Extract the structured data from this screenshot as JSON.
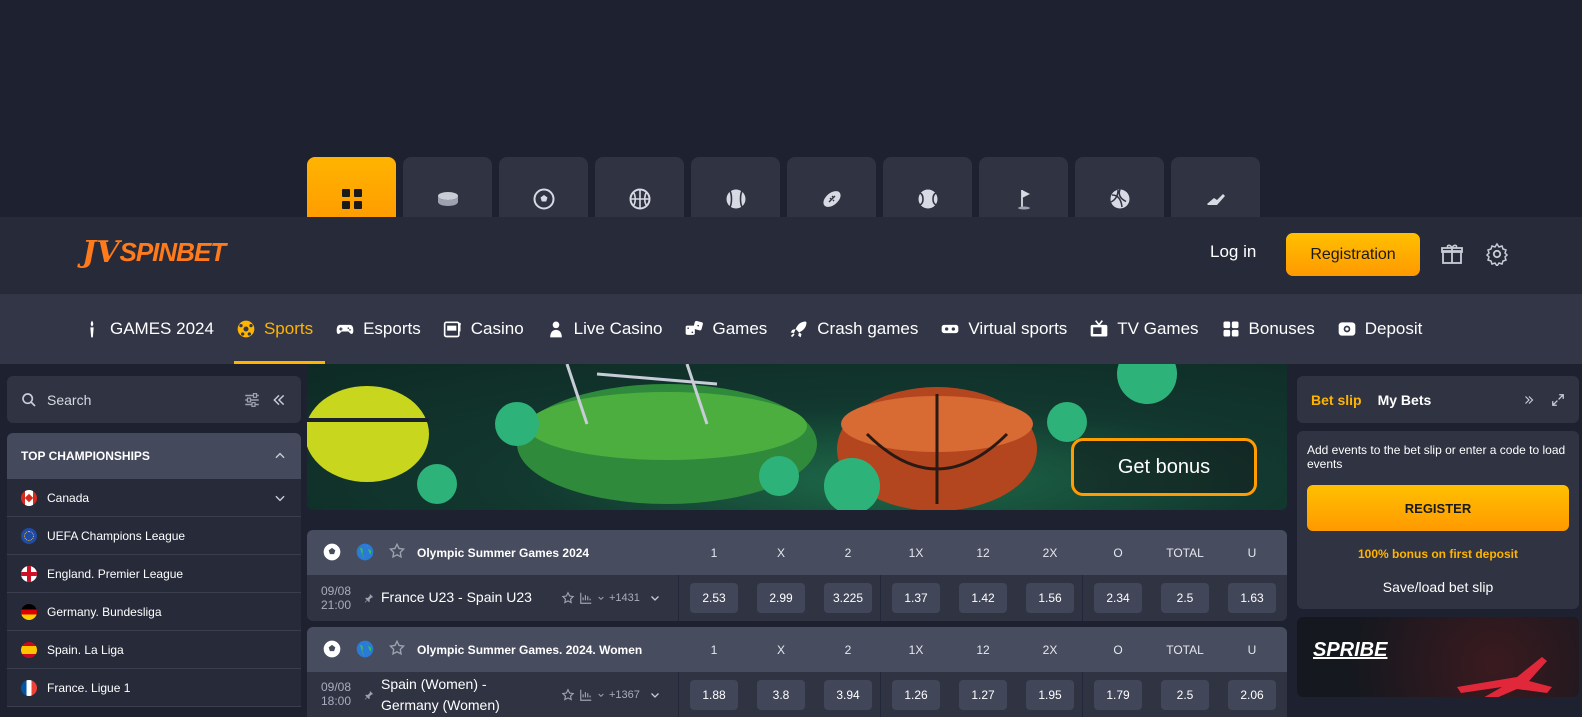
{
  "tiles": [
    {
      "icon": "grid-icon",
      "active": true
    },
    {
      "icon": "puck-icon"
    },
    {
      "icon": "soccer-ball-icon"
    },
    {
      "icon": "basketball-icon"
    },
    {
      "icon": "baseball-icon"
    },
    {
      "icon": "american-football-icon"
    },
    {
      "icon": "tennis-ball-icon"
    },
    {
      "icon": "golf-flag-icon"
    },
    {
      "icon": "volleyball-icon"
    },
    {
      "icon": "sneaker-icon"
    }
  ],
  "header": {
    "logo_mark": "JV",
    "logo_text": "SPINBET",
    "login_label": "Log in",
    "register_label": "Registration"
  },
  "nav": [
    {
      "label": "GAMES 2024",
      "icon": "torch-icon"
    },
    {
      "label": "Sports",
      "icon": "sports-icon",
      "active": true
    },
    {
      "label": "Esports",
      "icon": "gamepad-icon"
    },
    {
      "label": "Casino",
      "icon": "slot-icon"
    },
    {
      "label": "Live Casino",
      "icon": "dealer-icon"
    },
    {
      "label": "Games",
      "icon": "dice-icon"
    },
    {
      "label": "Crash games",
      "icon": "rocket-icon"
    },
    {
      "label": "Virtual sports",
      "icon": "vr-icon"
    },
    {
      "label": "TV Games",
      "icon": "tv-icon"
    },
    {
      "label": "Bonuses",
      "icon": "gift-box-icon"
    },
    {
      "label": "Deposit",
      "icon": "wallet-icon"
    }
  ],
  "sidebar": {
    "search_placeholder": "Search",
    "top_title": "TOP CHAMPIONSHIPS",
    "items": [
      {
        "label": "Canada",
        "flag": "ca"
      },
      {
        "label": "UEFA Champions League",
        "flag": "eu"
      },
      {
        "label": "England. Premier League",
        "flag": "en"
      },
      {
        "label": "Germany. Bundesliga",
        "flag": "de"
      },
      {
        "label": "Spain. La Liga",
        "flag": "es"
      },
      {
        "label": "France. Ligue 1",
        "flag": "fr"
      }
    ]
  },
  "banner": {
    "cta": "Get bonus"
  },
  "columns": [
    "1",
    "X",
    "2",
    "1X",
    "12",
    "2X",
    "O",
    "TOTAL",
    "U"
  ],
  "events": [
    {
      "title": "Olympic Summer Games 2024",
      "date": "09/08",
      "time": "21:00",
      "teams": "France U23 - Spain U23",
      "markets": "+1431",
      "odds": [
        "2.53",
        "2.99",
        "3.225",
        "1.37",
        "1.42",
        "1.56",
        "2.34",
        "2.5",
        "1.63"
      ]
    },
    {
      "title": "Olympic Summer Games. 2024. Women",
      "date": "09/08",
      "time": "18:00",
      "teams": "Spain (Women) - Germany (Women)",
      "markets": "+1367",
      "odds": [
        "1.88",
        "3.8",
        "3.94",
        "1.26",
        "1.27",
        "1.95",
        "1.79",
        "2.5",
        "2.06"
      ]
    }
  ],
  "betslip": {
    "tab_slip": "Bet slip",
    "tab_mybets": "My Bets",
    "info": "Add events to the bet slip or enter a code to load events",
    "register": "REGISTER",
    "bonus": "100% bonus on first deposit",
    "save": "Save/load bet slip"
  },
  "promo": {
    "title": "SPRIBE"
  },
  "colors": {
    "accent": "#ffb400",
    "bg": "#1e2130",
    "panel": "#2f3342"
  }
}
